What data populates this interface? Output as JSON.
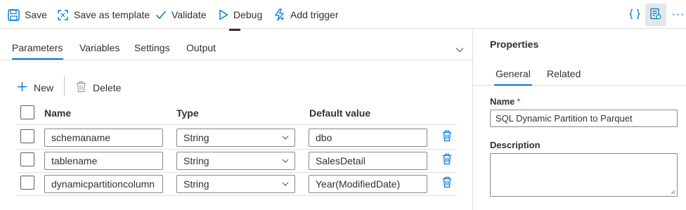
{
  "toolbar": {
    "save_label": "Save",
    "save_as_template_label": "Save as template",
    "validate_label": "Validate",
    "debug_label": "Debug",
    "add_trigger_label": "Add trigger",
    "more_label": "···"
  },
  "colors": {
    "accent": "#0078d4",
    "icon_blue": "#0078d4",
    "required": "#a4262c"
  },
  "left_panel": {
    "tabs": [
      {
        "label": "Parameters",
        "active": true
      },
      {
        "label": "Variables",
        "active": false
      },
      {
        "label": "Settings",
        "active": false
      },
      {
        "label": "Output",
        "active": false
      }
    ],
    "commands": {
      "new_label": "New",
      "delete_label": "Delete"
    },
    "table": {
      "headers": {
        "name": "Name",
        "type": "Type",
        "default_value": "Default value"
      },
      "rows": [
        {
          "name": "schemaname",
          "type": "String",
          "default_value": "dbo"
        },
        {
          "name": "tablename",
          "type": "String",
          "default_value": "SalesDetail"
        },
        {
          "name": "dynamicpartitioncolumn",
          "type": "String",
          "default_value": "Year(ModifiedDate)"
        }
      ]
    }
  },
  "properties": {
    "title": "Properties",
    "tabs": [
      {
        "label": "General",
        "active": true
      },
      {
        "label": "Related",
        "active": false
      }
    ],
    "name_label": "Name",
    "name_required_marker": "*",
    "name_value": "SQL Dynamic Partition to Parquet",
    "description_label": "Description",
    "description_value": ""
  }
}
